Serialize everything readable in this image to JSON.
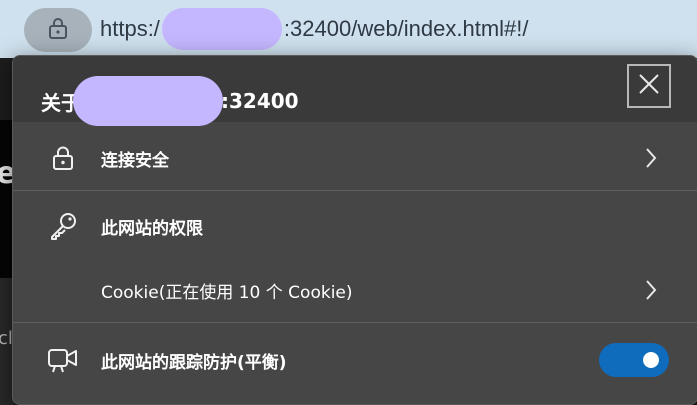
{
  "address_bar": {
    "url_prefix": "https:/",
    "url_suffix": ":32400/web/index.html#!/"
  },
  "background": {
    "glyph_e": "e",
    "glyph_c": "cl"
  },
  "panel": {
    "title_prefix": "关于",
    "title_suffix": ":32400",
    "rows": {
      "secure": {
        "label": "连接安全"
      },
      "permissions": {
        "label": "此网站的权限"
      },
      "cookies": {
        "label": "Cookie(正在使用 10 个 Cookie)"
      },
      "tracking": {
        "label": "此网站的跟踪防护(平衡)",
        "enabled": true
      }
    }
  },
  "colors": {
    "panel_bg": "#464646",
    "header_bg": "#3a3a3a",
    "toggle_on": "#0f6cbd",
    "redaction": "#c5b7ff",
    "address_bar_bg": "#cfe1ee"
  }
}
